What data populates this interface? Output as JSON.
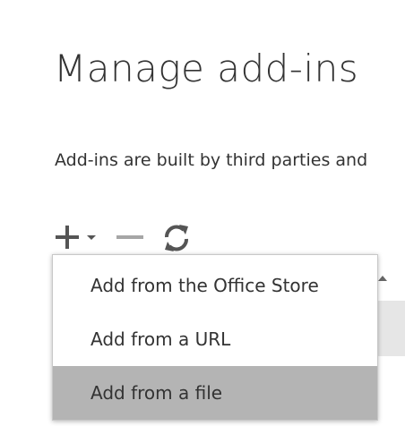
{
  "page": {
    "title": "Manage add-ins",
    "description": "Add-ins are built by third parties and"
  },
  "toolbar": {
    "add_icon": "plus-icon",
    "add_dropdown_icon": "caret-down-icon",
    "remove_icon": "minus-icon",
    "refresh_icon": "refresh-icon"
  },
  "menu": {
    "items": [
      {
        "label": "Add from the Office Store",
        "highlighted": false
      },
      {
        "label": "Add from a URL",
        "highlighted": false
      },
      {
        "label": "Add from a file",
        "highlighted": true
      }
    ]
  },
  "colors": {
    "text": "#333333",
    "icon": "#555555",
    "disabled_icon": "#a6a6a6",
    "menu_highlight": "#b4b4b4",
    "row_background": "#e6e6e6"
  }
}
